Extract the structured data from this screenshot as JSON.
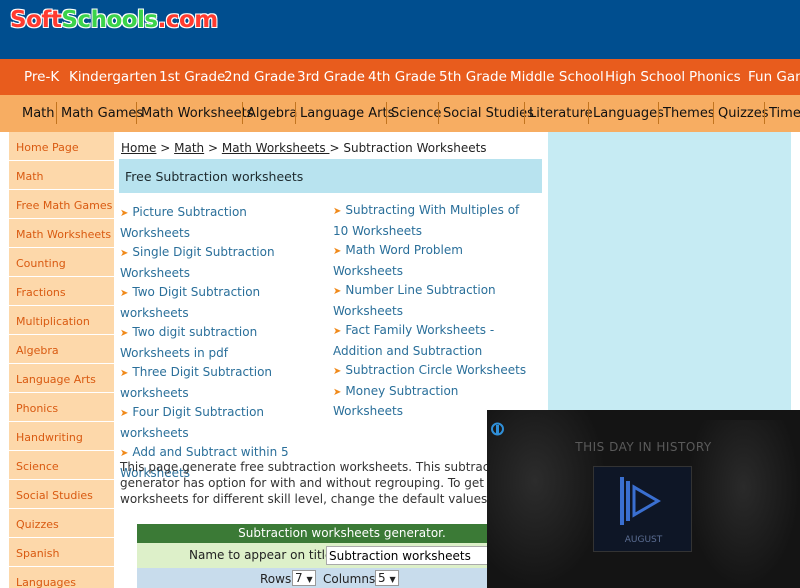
{
  "logo": {
    "part1": "Soft",
    "part2": "Schools",
    "part3": ".com"
  },
  "grades": [
    "Pre-K",
    "Kindergarten",
    "1st Grade",
    "2nd Grade",
    "3rd Grade",
    "4th Grade",
    "5th Grade",
    "Middle School",
    "High School",
    "Phonics",
    "Fun Games"
  ],
  "subjects": [
    "Math",
    "Math Games",
    "Math Worksheets",
    "Algebra",
    "Language Arts",
    "Science",
    "Social Studies",
    "Literature",
    "Languages",
    "Themes",
    "Quizzes",
    "Timelines"
  ],
  "sidebar": [
    "Home Page",
    "Math",
    "Free Math Games",
    "Math Worksheets",
    "Counting",
    "Fractions",
    "Multiplication",
    "Algebra",
    "Language Arts",
    "Phonics",
    "Handwriting",
    "Science",
    "Social Studies",
    "Quizzes",
    "Spanish",
    "Languages"
  ],
  "breadcrumb": {
    "home": "Home",
    "sep": " > ",
    "math": "Math",
    "worksheets": "Math Worksheets ",
    "current": "Subtraction Worksheets"
  },
  "page_title": "Free Subtraction worksheets",
  "links_col1": [
    {
      "lines": [
        "Picture Subtraction Worksheets"
      ]
    },
    {
      "lines": [
        "Single Digit Subtraction",
        "Worksheets"
      ]
    },
    {
      "lines": [
        "Two Digit Subtraction",
        "worksheets"
      ]
    },
    {
      "lines": [
        "Two digit subtraction",
        "Worksheets in pdf"
      ]
    },
    {
      "lines": [
        "Three Digit Subtraction",
        "worksheets"
      ]
    },
    {
      "lines": [
        "Four Digit Subtraction",
        "worksheets"
      ]
    },
    {
      "lines": [
        "Add and Subtract within 5",
        "Worksheets"
      ]
    }
  ],
  "links_col2": [
    {
      "lines": [
        "Subtracting With Multiples of",
        "10 Worksheets"
      ]
    },
    {
      "lines": [
        "Math Word Problem",
        "Worksheets"
      ]
    },
    {
      "lines": [
        "Number Line Subtraction",
        "Worksheets"
      ]
    },
    {
      "lines": [
        "Fact Family Worksheets -",
        "Addition and Subtraction"
      ]
    },
    {
      "lines": [
        "Subtraction Circle Worksheets"
      ]
    },
    {
      "lines": [
        "Money Subtraction",
        "Worksheets"
      ]
    }
  ],
  "description": [
    "This page generate free subtraction worksheets. This subtraction w",
    "generator has option for with and without regrouping. To get subtr",
    "worksheets for different skill level, change the default values."
  ],
  "generator": {
    "title": "Subtraction worksheets generator.",
    "name_label": "Name to appear on title:",
    "name_value": "Subtraction worksheets",
    "rows_label": "Rows:",
    "rows_value": "7",
    "columns_label": "Columns:",
    "columns_value": "5"
  },
  "video": {
    "title": "THIS DAY IN HISTORY",
    "month": "AUGUST"
  },
  "colors": {
    "header": "#004e8f",
    "grade_bar": "#e85c1d",
    "subject_bar": "#f7ad62",
    "sidebar_bg": "#fdd8aa",
    "link": "#2a6f9a",
    "title_bg": "#b8e3ef"
  }
}
